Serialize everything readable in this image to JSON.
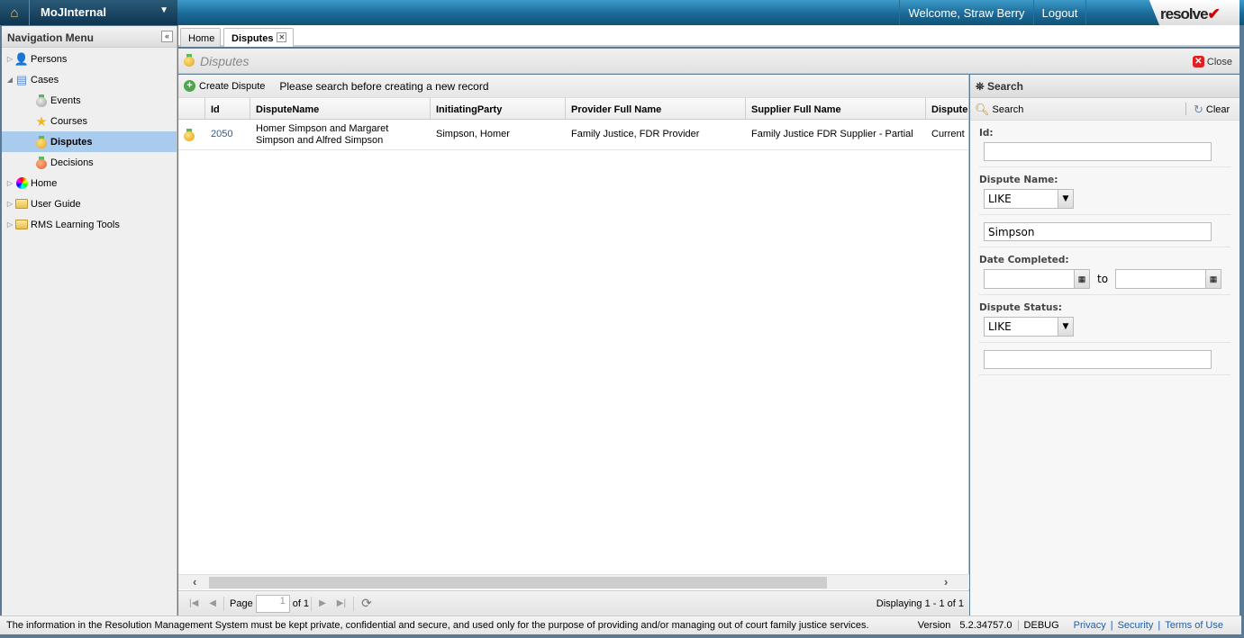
{
  "topbar": {
    "app_name": "MoJInternal",
    "welcome": "Welcome, Straw Berry",
    "logout": "Logout",
    "logo_text": "resolve"
  },
  "nav": {
    "title": "Navigation Menu",
    "items": [
      {
        "label": "Persons",
        "icon": "persons-icon"
      },
      {
        "label": "Cases",
        "icon": "cases-icon"
      },
      {
        "label": "Events",
        "icon": "medal-grey-icon"
      },
      {
        "label": "Courses",
        "icon": "star-icon"
      },
      {
        "label": "Disputes",
        "icon": "medal-gold-icon",
        "selected": true
      },
      {
        "label": "Decisions",
        "icon": "medal-orange-icon"
      },
      {
        "label": "Home",
        "icon": "color-wheel-icon"
      },
      {
        "label": "User Guide",
        "icon": "folder-icon"
      },
      {
        "label": "RMS Learning Tools",
        "icon": "folder-icon"
      }
    ]
  },
  "tabs": [
    {
      "label": "Home"
    },
    {
      "label": "Disputes",
      "active": true
    }
  ],
  "page": {
    "title": "Disputes",
    "close": "Close"
  },
  "grid": {
    "create": "Create Dispute",
    "hint": "Please search before creating a new record",
    "columns": [
      "Id",
      "DisputeName",
      "InitiatingParty",
      "Provider Full Name",
      "Supplier Full Name",
      "Dispute"
    ],
    "rows": [
      {
        "id": "2050",
        "name": "Homer Simpson and Margaret Simpson and Alfred Simpson",
        "party": "Simpson, Homer",
        "provider": "Family Justice, FDR Provider",
        "supplier": "Family Justice FDR Supplier - Partial",
        "status": "Current"
      }
    ]
  },
  "pager": {
    "page_label": "Page",
    "page": "1",
    "of": "of 1",
    "displaying": "Displaying 1 - 1 of 1"
  },
  "search": {
    "title": "Search",
    "search_btn": "Search",
    "clear_btn": "Clear",
    "id_label": "Id:",
    "id_value": "",
    "name_label": "Dispute Name:",
    "name_op": "LIKE",
    "name_value": "Simpson",
    "date_label": "Date Completed:",
    "date_to": "to",
    "date_from_value": "",
    "date_to_value": "",
    "status_label": "Dispute Status:",
    "status_op": "LIKE",
    "status_value": ""
  },
  "footer": {
    "notice": "The information in the Resolution Management System must be kept private, confidential and secure, and used only for the purpose of providing and/or managing out of court family justice services.",
    "version_label": "Version",
    "version": "5.2.34757.0",
    "mode": "DEBUG",
    "privacy": "Privacy",
    "security": "Security",
    "terms": "Terms of Use"
  }
}
